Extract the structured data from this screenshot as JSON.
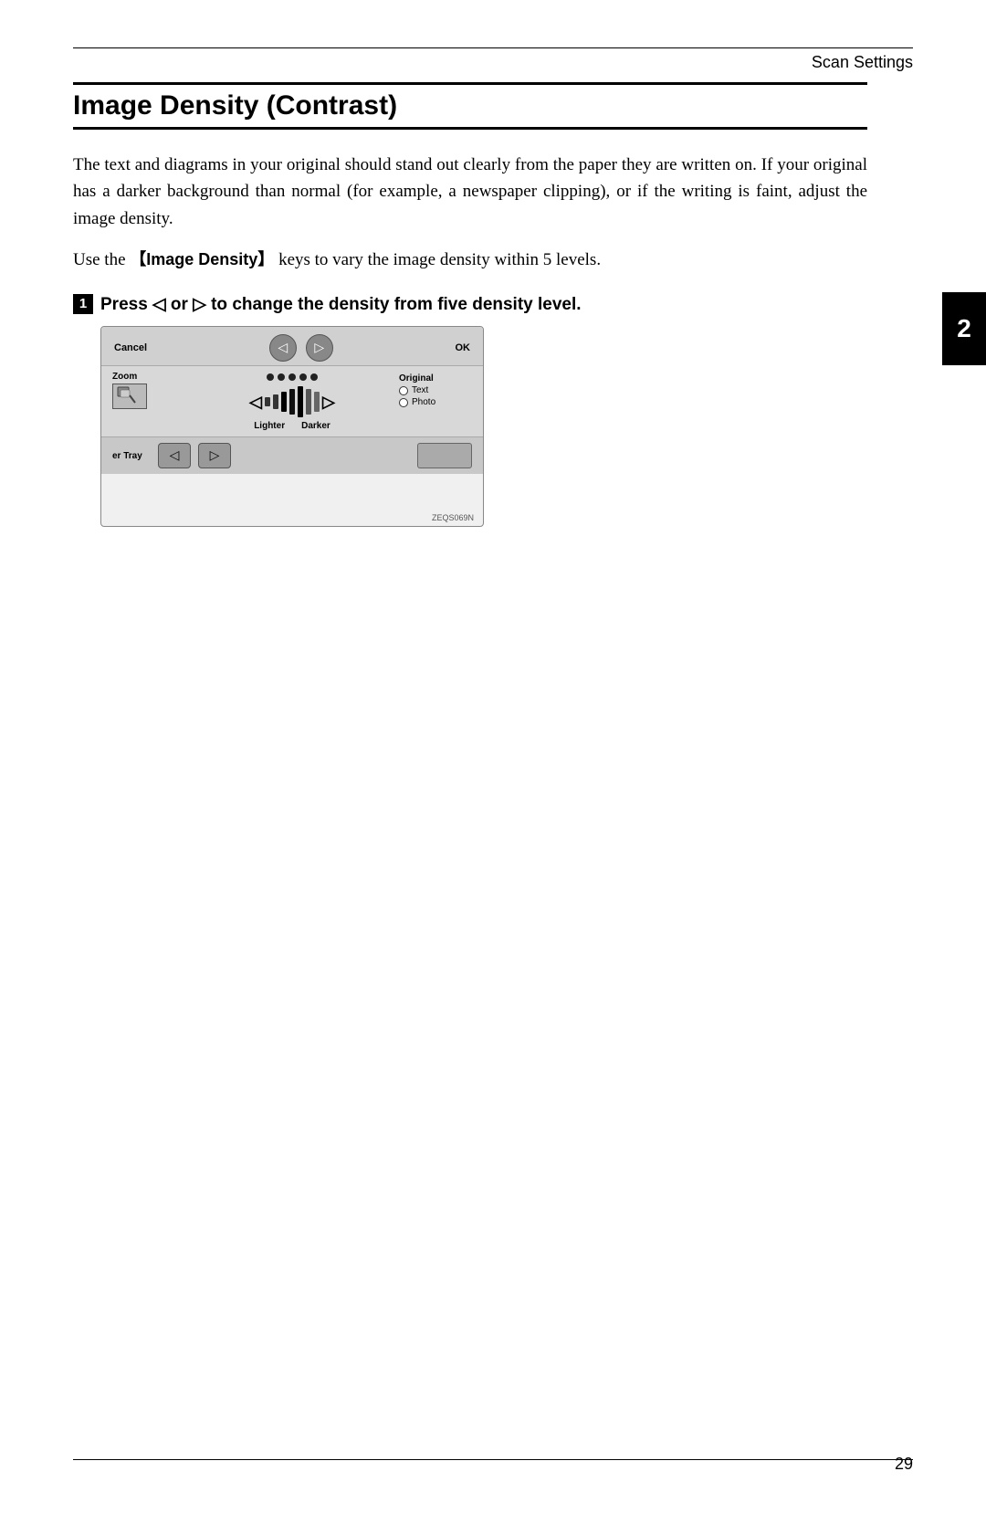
{
  "header": {
    "line_visible": true,
    "section_label": "Scan Settings"
  },
  "chapter_tab": {
    "number": "2"
  },
  "section_title": "Image Density (Contrast)",
  "body_paragraphs": {
    "p1": "The text and diagrams in your original should stand out clearly from the paper they are written on. If your original has a darker background than normal (for example, a newspaper clipping), or if the writing is faint, adjust the image density.",
    "p2_prefix": "Use the ",
    "p2_key": "【Image Density】",
    "p2_suffix": " keys to vary the image density within 5 levels."
  },
  "step1": {
    "number": "1",
    "text_bold": "Press ◁  or  ▷ to change the density from five density level."
  },
  "device_diagram": {
    "cancel_label": "Cancel",
    "ok_label": "OK",
    "zoom_label": "Zoom",
    "lighter_label": "Lighter",
    "darker_label": "Darker",
    "original_label": "Original",
    "text_option": "Text",
    "photo_option": "Photo",
    "tray_label": "er Tray",
    "code": "ZEQS069N",
    "dots_count": 5,
    "density_bars": [
      1,
      2,
      3,
      4,
      5,
      6,
      7
    ]
  },
  "page_number": "29"
}
